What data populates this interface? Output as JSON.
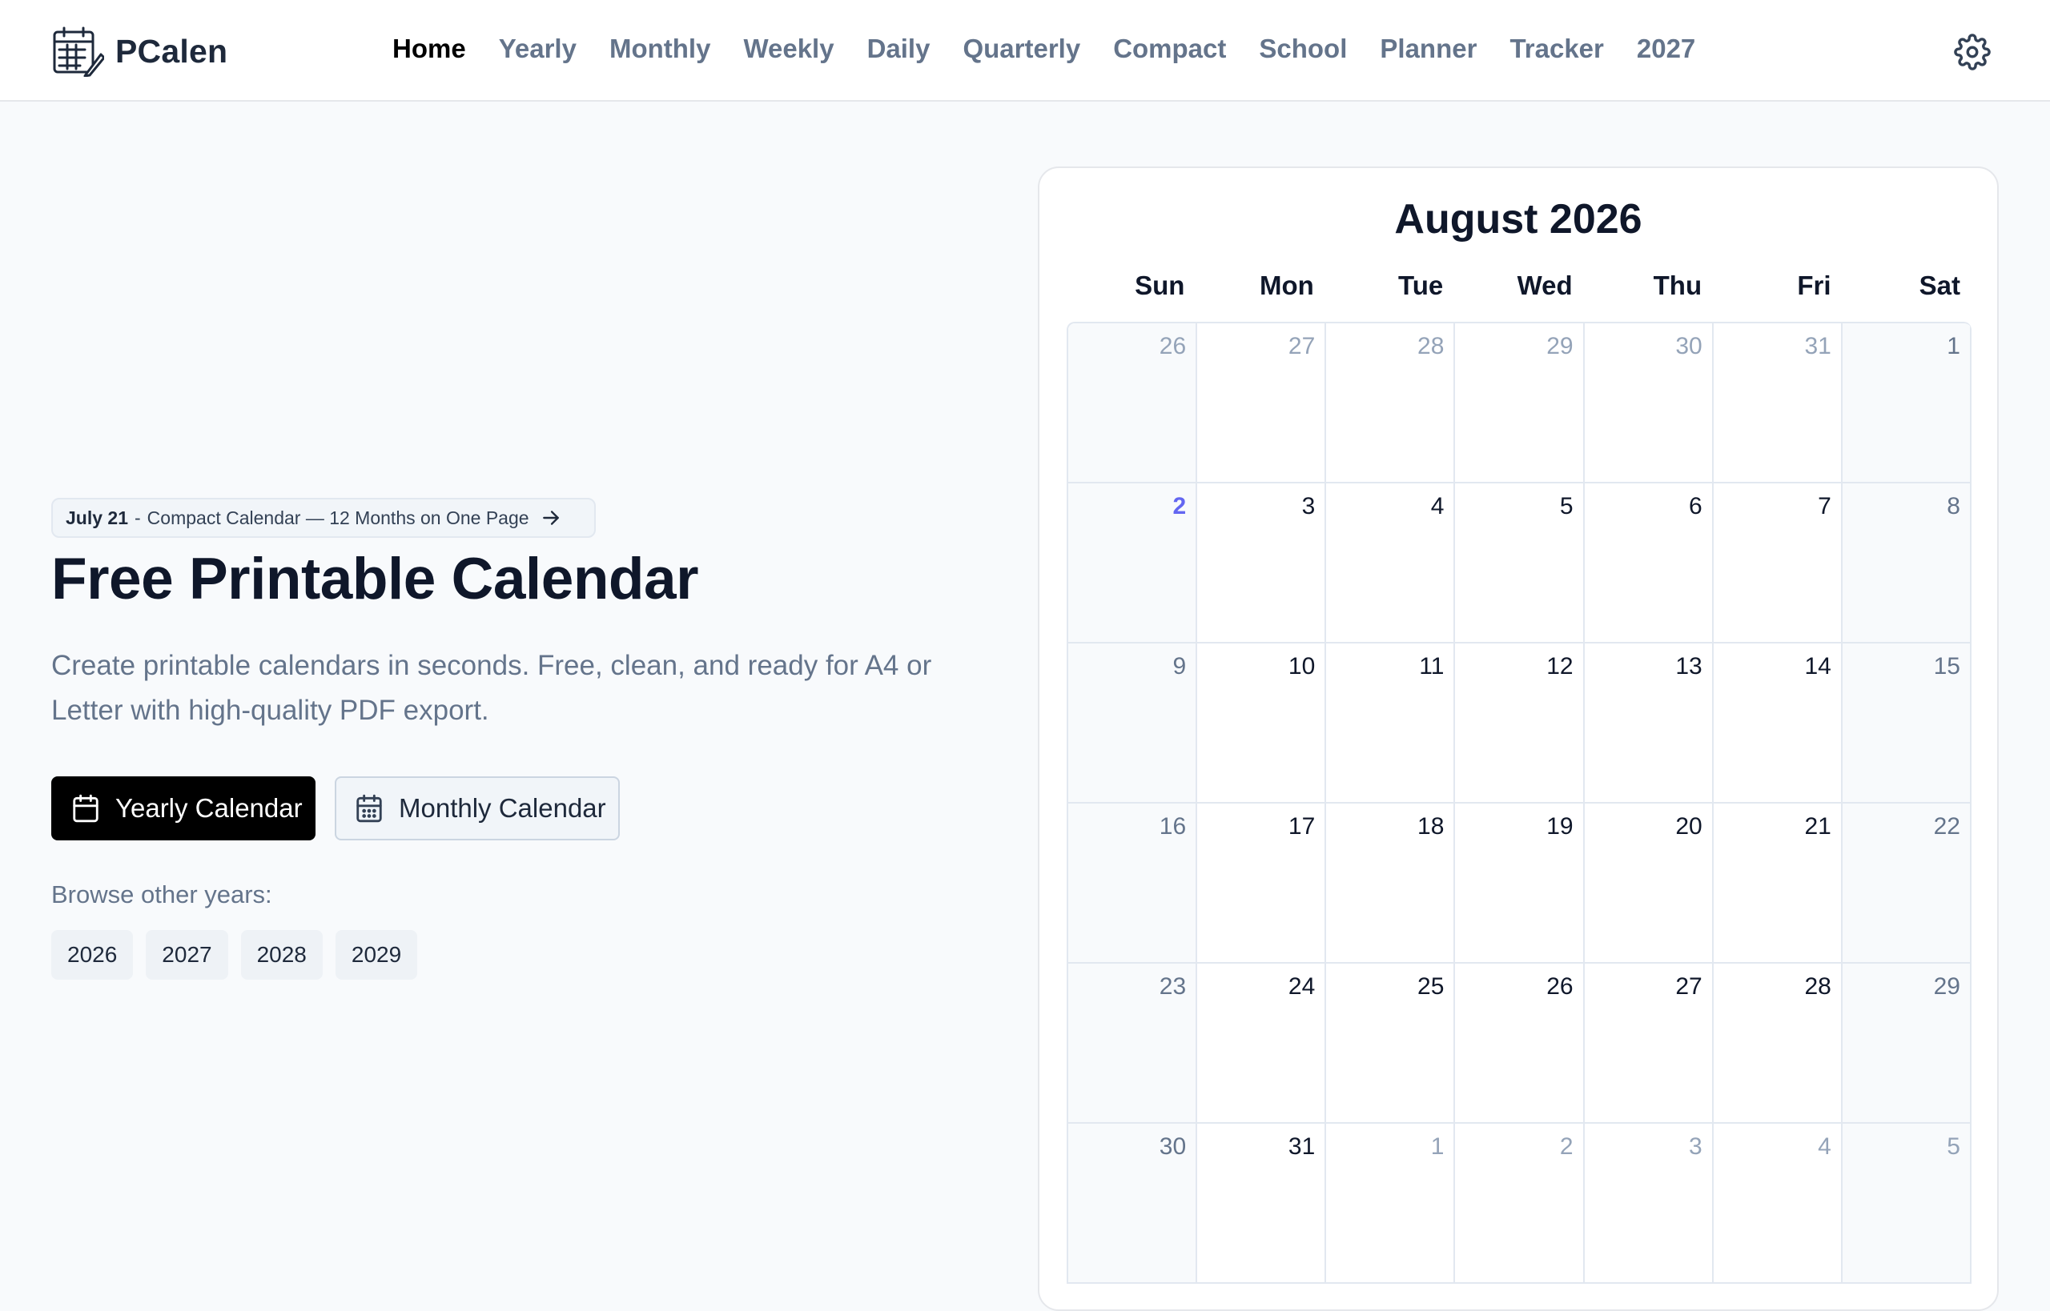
{
  "header": {
    "brand": "PCalen",
    "nav": [
      {
        "label": "Home",
        "active": true
      },
      {
        "label": "Yearly"
      },
      {
        "label": "Monthly"
      },
      {
        "label": "Weekly"
      },
      {
        "label": "Daily"
      },
      {
        "label": "Quarterly"
      },
      {
        "label": "Compact"
      },
      {
        "label": "School"
      },
      {
        "label": "Planner"
      },
      {
        "label": "Tracker"
      },
      {
        "label": "2027"
      }
    ],
    "settings_icon": "gear-icon"
  },
  "hero": {
    "announcement": {
      "date": "July 21",
      "separator": "-",
      "text": "Compact Calendar — 12 Months on One Page",
      "icon": "arrow-right-icon"
    },
    "title": "Free Printable Calendar",
    "description": "Create printable calendars in seconds. Free, clean, and ready for A4 or Letter with high-quality PDF export.",
    "primary_button": {
      "label": "Yearly Calendar",
      "icon": "calendar-icon"
    },
    "secondary_button": {
      "label": "Monthly Calendar",
      "icon": "calendar-grid-icon"
    },
    "browse_label": "Browse other years:",
    "years": [
      "2026",
      "2027",
      "2028",
      "2029"
    ]
  },
  "calendar": {
    "title": "August 2026",
    "weekdays": [
      "Sun",
      "Mon",
      "Tue",
      "Wed",
      "Thu",
      "Fri",
      "Sat"
    ],
    "weeks": [
      [
        {
          "d": "26",
          "o": true
        },
        {
          "d": "27",
          "o": true
        },
        {
          "d": "28",
          "o": true
        },
        {
          "d": "29",
          "o": true
        },
        {
          "d": "30",
          "o": true
        },
        {
          "d": "31",
          "o": true
        },
        {
          "d": "1"
        }
      ],
      [
        {
          "d": "2",
          "today": true
        },
        {
          "d": "3"
        },
        {
          "d": "4"
        },
        {
          "d": "5"
        },
        {
          "d": "6"
        },
        {
          "d": "7"
        },
        {
          "d": "8"
        }
      ],
      [
        {
          "d": "9"
        },
        {
          "d": "10"
        },
        {
          "d": "11"
        },
        {
          "d": "12"
        },
        {
          "d": "13"
        },
        {
          "d": "14"
        },
        {
          "d": "15"
        }
      ],
      [
        {
          "d": "16"
        },
        {
          "d": "17"
        },
        {
          "d": "18"
        },
        {
          "d": "19"
        },
        {
          "d": "20"
        },
        {
          "d": "21"
        },
        {
          "d": "22"
        }
      ],
      [
        {
          "d": "23"
        },
        {
          "d": "24"
        },
        {
          "d": "25"
        },
        {
          "d": "26"
        },
        {
          "d": "27"
        },
        {
          "d": "28"
        },
        {
          "d": "29"
        }
      ],
      [
        {
          "d": "30"
        },
        {
          "d": "31"
        },
        {
          "d": "1",
          "o": true
        },
        {
          "d": "2",
          "o": true
        },
        {
          "d": "3",
          "o": true
        },
        {
          "d": "4",
          "o": true
        },
        {
          "d": "5",
          "o": true
        }
      ]
    ],
    "today_color": "#6366f1"
  }
}
